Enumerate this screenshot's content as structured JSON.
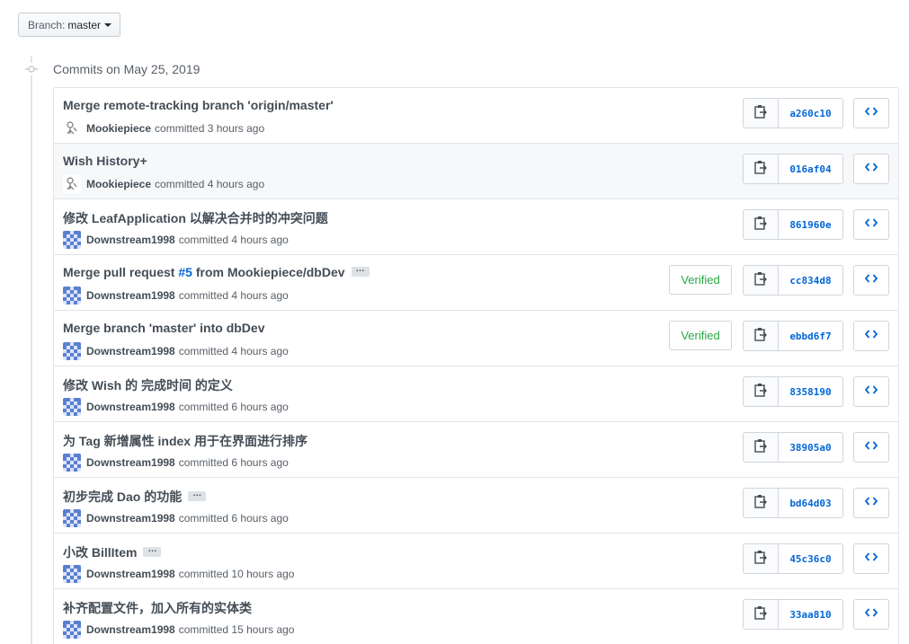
{
  "branch": {
    "label": "Branch:",
    "value": "master"
  },
  "group": {
    "title": "Commits on May 25, 2019"
  },
  "commits": [
    {
      "title": "Merge remote-tracking branch 'origin/master'",
      "author": "Mookiepiece",
      "action": "committed",
      "time": "3 hours ago",
      "sha": "a260c10",
      "verified": "",
      "avatar": "mookie"
    },
    {
      "title": "Wish History+",
      "author": "Mookiepiece",
      "action": "committed",
      "time": "4 hours ago",
      "sha": "016af04",
      "verified": "",
      "avatar": "mookie"
    },
    {
      "title": "修改 LeafApplication 以解决合并时的冲突问题",
      "author": "Downstream1998",
      "action": "committed",
      "time": "4 hours ago",
      "sha": "861960e",
      "verified": "",
      "avatar": "down"
    },
    {
      "title_prefix": "Merge pull request ",
      "pr": "#5",
      "title_suffix": " from Mookiepiece/dbDev",
      "author": "Downstream1998",
      "action": "committed",
      "time": "4 hours ago",
      "sha": "cc834d8",
      "verified": "Verified",
      "avatar": "down"
    },
    {
      "title": "Merge branch 'master' into dbDev",
      "author": "Downstream1998",
      "action": "committed",
      "time": "4 hours ago",
      "sha": "ebbd6f7",
      "verified": "Verified",
      "avatar": "down"
    },
    {
      "title": "修改 Wish 的 完成时间 的定义",
      "author": "Downstream1998",
      "action": "committed",
      "time": "6 hours ago",
      "sha": "8358190",
      "verified": "",
      "avatar": "down"
    },
    {
      "title": "为 Tag 新增属性 index 用于在界面进行排序",
      "author": "Downstream1998",
      "action": "committed",
      "time": "6 hours ago",
      "sha": "38905a0",
      "verified": "",
      "avatar": "down"
    },
    {
      "title": "初步完成 Dao 的功能",
      "author": "Downstream1998",
      "action": "committed",
      "time": "6 hours ago",
      "sha": "bd64d03",
      "verified": "",
      "avatar": "down"
    },
    {
      "title": "小改 BillItem",
      "author": "Downstream1998",
      "action": "committed",
      "time": "10 hours ago",
      "sha": "45c36c0",
      "verified": "",
      "avatar": "down"
    },
    {
      "title": "补齐配置文件，加入所有的实体类",
      "author": "Downstream1998",
      "action": "committed",
      "time": "15 hours ago",
      "sha": "33aa810",
      "verified": "",
      "avatar": "down"
    }
  ],
  "ellipsis_label": "…",
  "icons": {
    "copy": "clipboard-icon",
    "browse": "code-icon",
    "node": "commit-node-icon",
    "caret": "caret-down-icon"
  },
  "colors": {
    "link": "#0366d6",
    "verified": "#28a745",
    "highlight_row": "#f6f8fa"
  }
}
